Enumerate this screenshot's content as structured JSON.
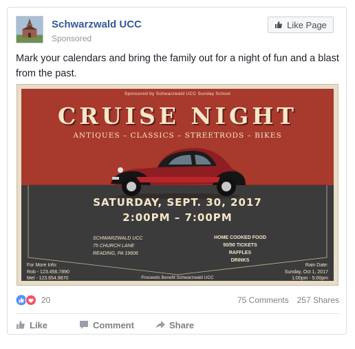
{
  "header": {
    "page_name": "Schwarzwald UCC",
    "sponsored": "Sponsored",
    "like_page_label": "Like Page"
  },
  "post": {
    "text": "Mark your calendars and bring the family out for a night of fun and a blast from the past."
  },
  "poster": {
    "sponsor_line": "Sponsored by Schwarzwald UCC Sunday School",
    "title": "CRUISE NIGHT",
    "subtitle": "ANTIQUES – CLASSICS – STREETRODS – BIKES",
    "date": "SATURDAY, SEPT. 30, 2017",
    "time": "2:00PM – 7:00PM",
    "address": [
      "SCHWARZWALD UCC",
      "75 CHURCH LANE",
      "READING, PA 19606"
    ],
    "extras": [
      "HOME COOKED FOOD",
      "50/50 TICKETS",
      "RAFFLES",
      "DRINKS"
    ],
    "info": [
      "For More Info:",
      "Rob - 123.456.7890",
      "Mel - 123.654.9870"
    ],
    "rain": [
      "Rain Date:",
      "Sunday, Oct 1, 2017",
      "1:00pm - 5:00pm"
    ],
    "proceeds": "Proceeds Benefit Schwarzwald UCC"
  },
  "stats": {
    "reaction_count": "20",
    "comments": "75 Comments",
    "shares": "257 Shares"
  },
  "actions": {
    "like": "Like",
    "comment": "Comment",
    "share": "Share"
  },
  "colors": {
    "link_blue": "#365899",
    "poster_red": "#a8392d",
    "poster_dark": "#3b3b3b",
    "poster_cream": "#f6e7c9",
    "like_blue": "#5890ff",
    "love_red": "#f25268"
  },
  "icons": {
    "avatar": "church-photo",
    "like_page": "thumbs-up-icon",
    "reactions": [
      "like-reaction-icon",
      "love-reaction-icon"
    ],
    "like_action": "thumbs-up-icon",
    "comment_action": "comment-icon",
    "share_action": "share-arrow-icon"
  }
}
